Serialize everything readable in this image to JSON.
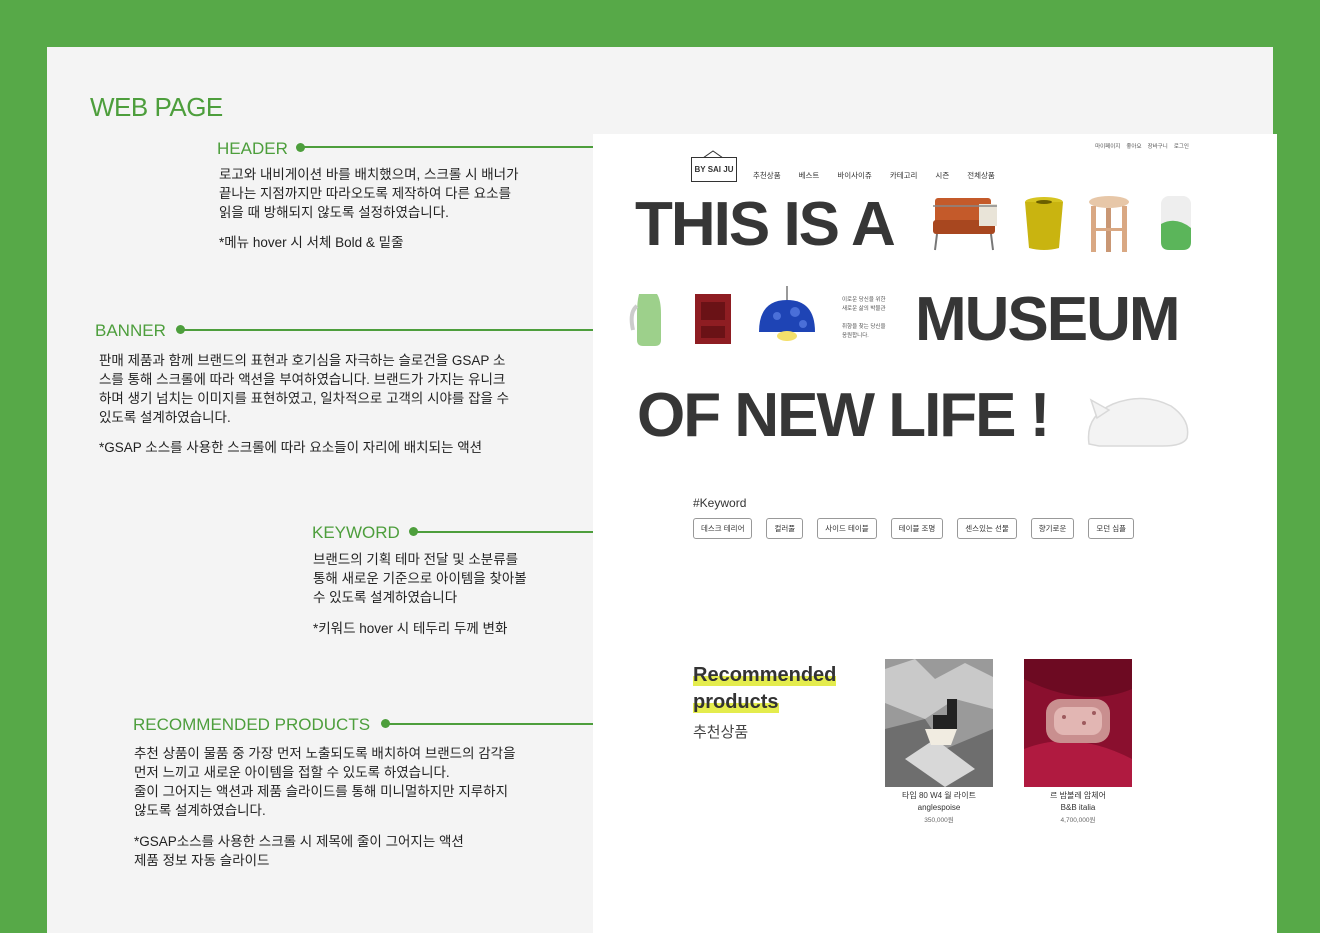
{
  "page_title": "WEB PAGE",
  "sections": {
    "header": {
      "title": "HEADER",
      "desc": "로고와 내비게이션 바를 배치했으며, 스크롤 시 배너가\n끝나는 지점까지만 따라오도록 제작하여 다른 요소를\n읽을 때 방해되지 않도록 설정하였습니다.",
      "note": "*메뉴 hover 시 서체 Bold & 밑줄"
    },
    "banner": {
      "title": "BANNER",
      "desc": "판매 제품과 함께 브랜드의 표현과 호기심을 자극하는 슬로건을 GSAP 소\n스를 통해 스크롤에 따라 액션을 부여하였습니다. 브랜드가 가지는 유니크\n하며 생기 넘치는 이미지를 표현하였고, 일차적으로 고객의 시야를 잡을 수\n있도록 설계하였습니다.",
      "note": "*GSAP 소스를 사용한 스크롤에 따라 요소들이 자리에 배치되는 액션"
    },
    "keyword": {
      "title": "KEYWORD",
      "desc": "브랜드의 기획 테마 전달 및 소분류를\n통해 새로운 기준으로 아이템을 찾아볼\n수 있도록 설계하였습니다",
      "note": "*키워드 hover 시 테두리 두께 변화"
    },
    "recommended": {
      "title": "RECOMMENDED PRODUCTS",
      "desc": "추천 상품이 물품 중 가장 먼저 노출되도록 배치하여 브랜드의 감각을\n먼저 느끼고 새로운 아이템을 접할 수 있도록 하였습니다.\n줄이 그어지는 액션과 제품 슬라이드를 통해 미니멀하지만 지루하지\n않도록 설계하였습니다.",
      "note": "*GSAP소스를 사용한 스크롤 시 제목에 줄이 그어지는 액션\n  제품 정보 자동 슬라이드"
    }
  },
  "site": {
    "util_links": [
      "마이페이지",
      "좋아요",
      "장바구니",
      "로그인"
    ],
    "logo": "BY SAI JU",
    "nav": [
      "추천상품",
      "베스트",
      "바이사이쥬",
      "카테고리",
      "시즌",
      "전체상품"
    ],
    "banner_lines": [
      "THIS IS A",
      "MUSEUM",
      "OF NEW LIFE !"
    ],
    "banner_copy": "이로운 당신을 위한\n새로운 삶의 박물관\n\n취향을 찾는 당신을\n응원합니다.",
    "keyword_title": "#Keyword",
    "keywords": [
      "데스크 테리어",
      "컬러풀",
      "사이드 테이블",
      "테이블 조명",
      "센스있는 선물",
      "향기로운",
      "모던 심플"
    ],
    "rec_title_line1": "Recommended",
    "rec_title_line2": "products",
    "rec_subtitle": "추천상품",
    "products": [
      {
        "name": "타입 80 W4 월 라이트",
        "brand": "anglespoise",
        "price": "350,000원"
      },
      {
        "name": "르 밤볼레 암체어",
        "brand": "B&B italia",
        "price": "4,700,000원"
      }
    ]
  },
  "colors": {
    "accent": "#4d9e3c",
    "frame": "#57a948",
    "highlight": "#e4ec4d"
  }
}
